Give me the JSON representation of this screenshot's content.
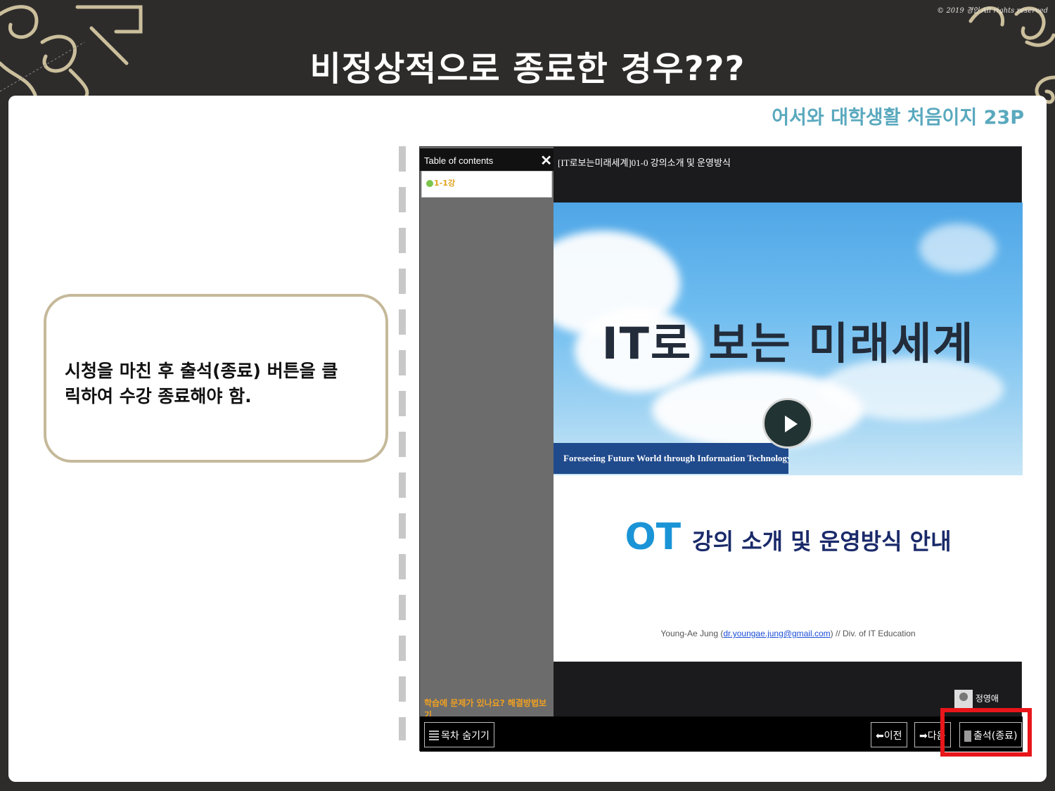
{
  "header": {
    "copyright": "© 2019 경인 All rights reserved",
    "title": "비정상적으로 종료한 경우???"
  },
  "reference": "어서와 대학생활 처음이지 23P",
  "callout": {
    "line1": "시청을 마친 후 출석(종료) 버튼을 클",
    "line2": "릭하여 수강 종료해야 함."
  },
  "player": {
    "toc_header": "Table of contents",
    "toc_close": "✕",
    "toc_item": "1-1강",
    "toc_help": "학습에 문제가 있나요? 해결방법보기",
    "lecture_title": "[IT로보는미래세계]01-0 강의소개 및 운영방식",
    "slide": {
      "heading": "IT로 보는 미래세계",
      "subtitle": "Foreseeing Future World through Information Technology",
      "ot": "OT",
      "ot_text": "강의 소개 및 운영방식 안내",
      "author_name": "Young-Ae Jung (",
      "author_email": "dr.youngae.jung@gmail.com",
      "author_rest": ") // Div. of IT Education"
    },
    "instructor": "정영애",
    "buttons": {
      "toc_hide": "목차 숨기기",
      "prev": "이전",
      "next": "다음",
      "exit": "출석(종료)"
    }
  },
  "colors": {
    "background": "#2e2c2b",
    "reference_text": "#5aa9be",
    "callout_border": "#c5b99a",
    "highlight": "#e8161a"
  }
}
